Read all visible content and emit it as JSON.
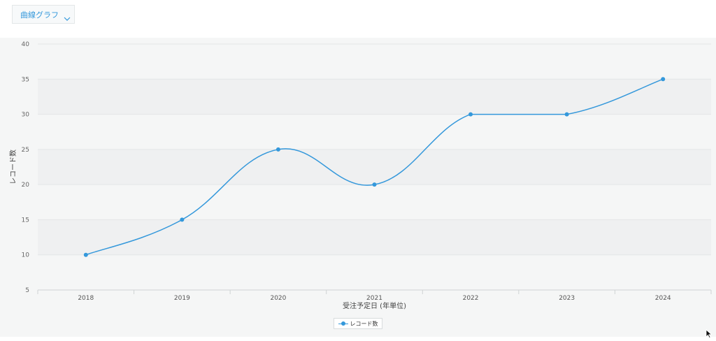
{
  "toolbar": {
    "chart_type_label": "曲線グラフ",
    "chart_type_icon": "chevron-down-icon"
  },
  "colors": {
    "series": "#3498db",
    "band_dark": "#eff0f1",
    "band_light": "#f5f6f6",
    "accent_text": "#3498db"
  },
  "chart_data": {
    "type": "line",
    "smooth": true,
    "categories": [
      "2018",
      "2019",
      "2020",
      "2021",
      "2022",
      "2023",
      "2024"
    ],
    "series": [
      {
        "name": "レコード数",
        "values": [
          10,
          15,
          25,
          20,
          30,
          30,
          35
        ]
      }
    ],
    "xlabel": "受注予定日 (年単位)",
    "ylabel": "レコード数",
    "ylim": [
      5,
      40
    ],
    "yticks": [
      "5",
      "10",
      "15",
      "20",
      "25",
      "30",
      "35",
      "40"
    ],
    "grid": "horizontal alternating bands",
    "legend": "bottom-center"
  },
  "legend": {
    "label": "レコード数"
  }
}
